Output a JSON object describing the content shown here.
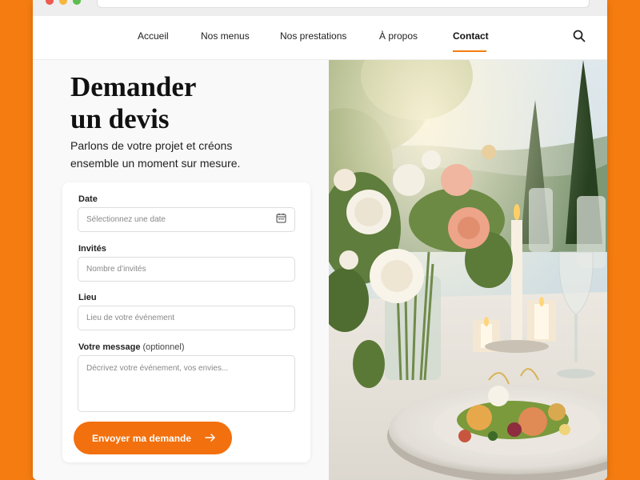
{
  "nav": {
    "items": [
      {
        "label": "Accueil"
      },
      {
        "label": "Nos menus"
      },
      {
        "label": "Nos prestations"
      },
      {
        "label": "À propos"
      },
      {
        "label": "Contact"
      }
    ],
    "active": "Contact",
    "search_icon": "search-icon"
  },
  "hero": {
    "title_line1": "Demander",
    "title_line2": "un devis",
    "subtitle_line1": "Parlons de votre projet et créons",
    "subtitle_line2": "ensemble un moment sur mesure."
  },
  "form": {
    "date": {
      "label": "Date",
      "placeholder": "Sélectionnez une date",
      "icon": "calendar-icon"
    },
    "guests": {
      "label": "Invités",
      "placeholder": "Nombre d’invités"
    },
    "location": {
      "label": "Lieu",
      "placeholder": "Lieu de votre événement"
    },
    "message": {
      "label": "Votre message",
      "optional": "(optionnel)",
      "placeholder": "Décrivez votre événement, vos envies..."
    },
    "submit": {
      "label": "Envoyer ma demande",
      "icon": "arrow-right-icon"
    }
  },
  "colors": {
    "accent": "#f57c10",
    "button": "#f2700e",
    "background_outer": "#f57c10",
    "text": "#222222"
  }
}
